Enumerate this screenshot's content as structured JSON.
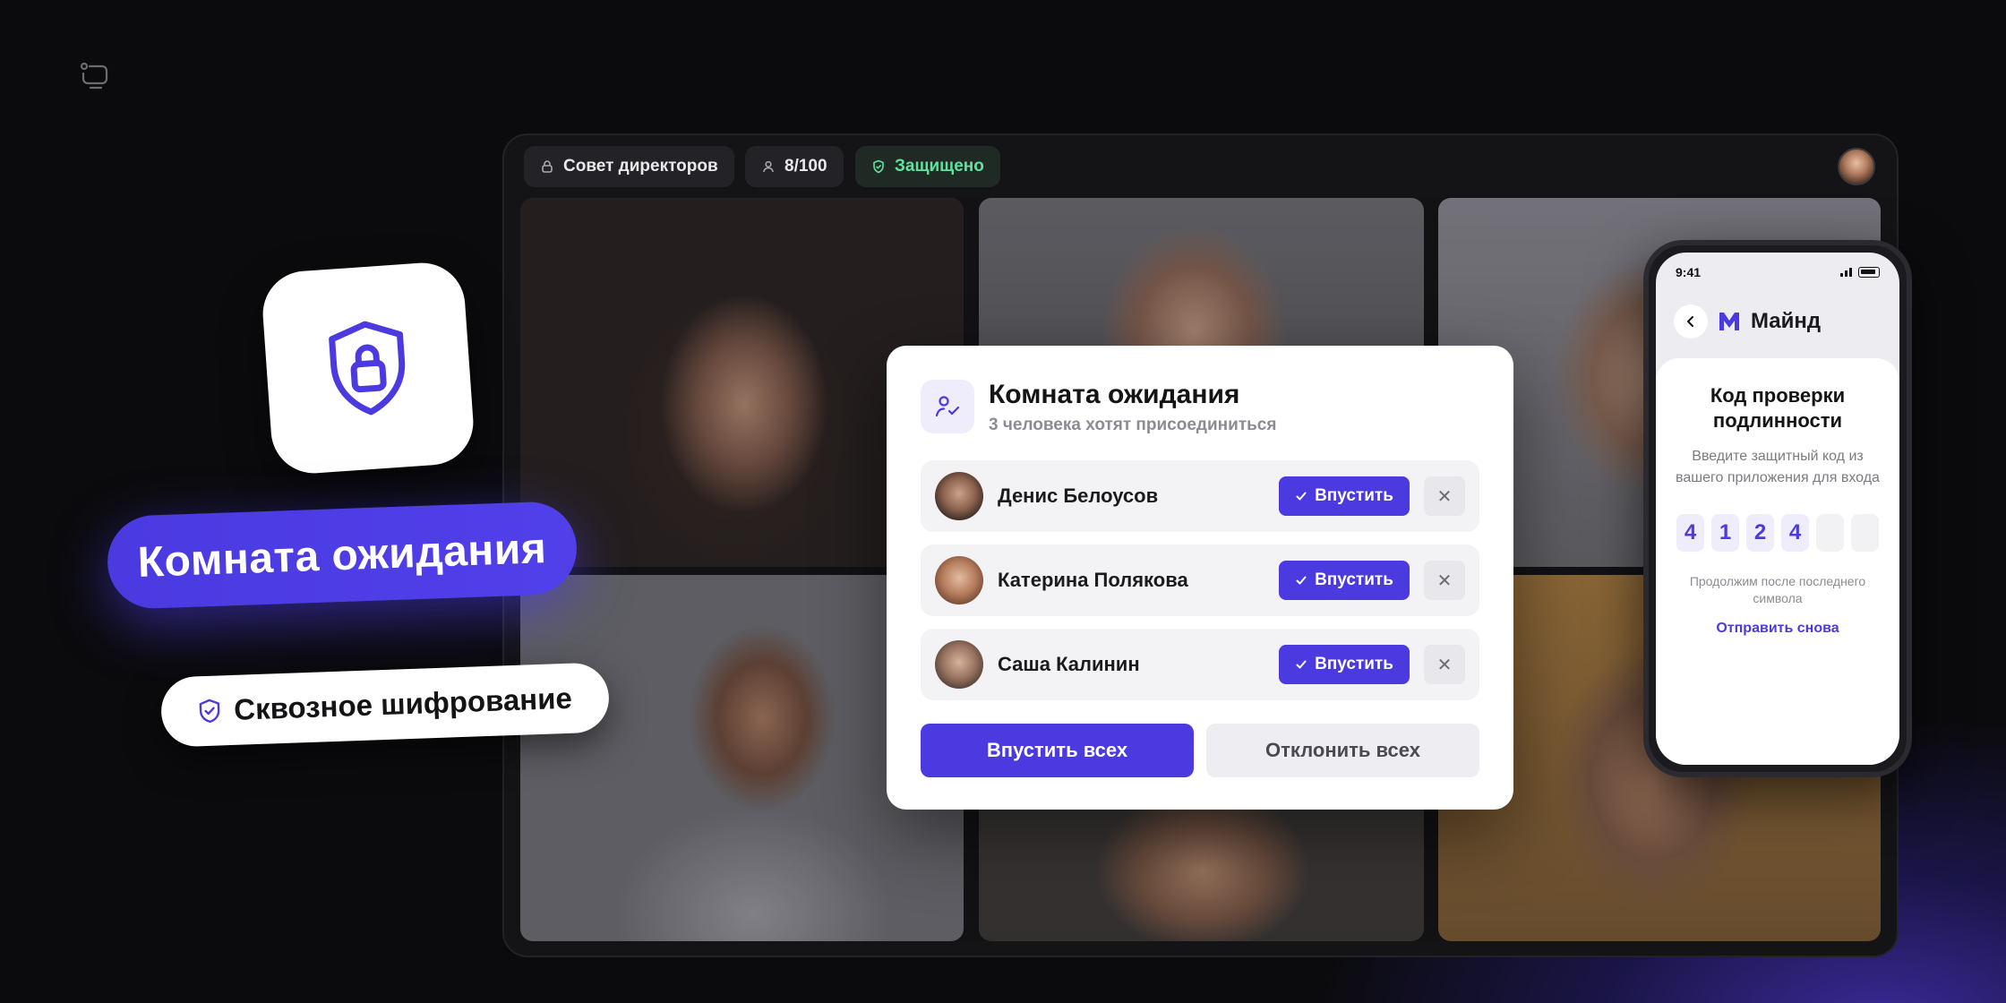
{
  "icons": {
    "logo": "screen-share-icon",
    "lock": "lock-icon",
    "user": "user-icon",
    "shield": "shield-check-icon",
    "big_shield": "shield-lock-icon",
    "waiting": "user-check-icon",
    "check": "check-icon",
    "close": "close-icon",
    "back": "chevron-left-icon",
    "brand": "m-logo-icon"
  },
  "colors": {
    "accent": "#4A3AE0",
    "secure": "#61E3A0",
    "background": "#0B0B0E"
  },
  "topbar": {
    "room_name": "Совет директоров",
    "participants": "8/100",
    "security": "Защищено"
  },
  "promo": {
    "title": "Комната ожидания",
    "encryption": "Сквозное шифрование"
  },
  "waiting_room": {
    "title": "Комната ожидания",
    "subtitle": "3 человека хотят присоединиться",
    "admit_label": "Впустить",
    "reject_label": "✕",
    "people": [
      {
        "name": "Денис Белоусов"
      },
      {
        "name": "Катерина Полякова"
      },
      {
        "name": "Саша Калинин"
      }
    ],
    "admit_all": "Впустить всех",
    "decline_all": "Отклонить всех"
  },
  "phone": {
    "time": "9:41",
    "app_name": "Майнд",
    "title": "Код проверки подлинности",
    "description": "Введите защитный код из вашего приложения для входа",
    "code_digits": [
      "4",
      "1",
      "2",
      "4",
      "",
      ""
    ],
    "hint": "Продолжим после последнего символа",
    "resend": "Отправить снова"
  }
}
